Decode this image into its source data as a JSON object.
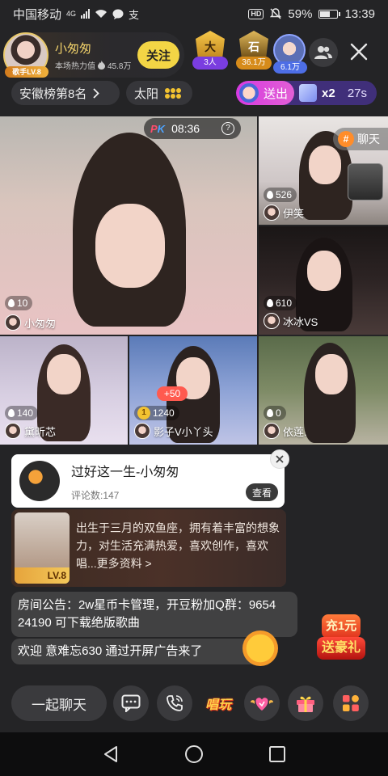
{
  "status_bar": {
    "carrier": "中国移动",
    "network": "4G",
    "misc_icon": "支",
    "hd": "HD",
    "battery": "59%",
    "battery_level": 0.59,
    "time": "13:39"
  },
  "host": {
    "name": "小匆匆",
    "heat_label": "本场热力值",
    "heat_value": "45.8万",
    "level_badge": "歌手LV.8",
    "follow_label": "关注"
  },
  "top_ranks": [
    {
      "crest": "大",
      "count": "3人",
      "icon": "crown-badge-icon"
    },
    {
      "crest": "石",
      "count": "36.1万",
      "icon": "crest-badge-icon"
    },
    {
      "count": "6.1万"
    }
  ],
  "rank_pill": {
    "label": "安徽榜第8名"
  },
  "sun_pill": {
    "label": "太阳"
  },
  "gift_pill": {
    "send_label": "送出",
    "multiplier": "x2",
    "timer": "27s"
  },
  "pk": {
    "label": "PK",
    "timer": "08:36"
  },
  "tiles": [
    {
      "likes": "10",
      "name": "小匆匆"
    },
    {
      "likes": "526",
      "name": "伊笑",
      "tag": "聊天"
    },
    {
      "likes": "610",
      "name": "冰冰VS"
    },
    {
      "likes": "140",
      "name": "黛昕芯"
    },
    {
      "likes": "1240",
      "name": "影子V小丫头",
      "coin": "1",
      "bonus": "+50"
    },
    {
      "likes": "0",
      "name": "依莲."
    }
  ],
  "song_card": {
    "title": "过好这一生-小匆匆",
    "comments": "评论数:147",
    "view_label": "查看"
  },
  "profile": {
    "lv": "LV.8",
    "text": "出生于三月的双鱼座，拥有着丰富的想象力，对生活充满热爱，喜欢创作，喜欢唱...更多资料 >"
  },
  "messages": {
    "announcement": "房间公告：2w星币卡管理，开豆粉加Q群：9654 24190 可下载绝版歌曲",
    "welcome": "欢迎 意难忘630 通过开屏广告来了"
  },
  "charge_badge": {
    "line1": "充1元",
    "line2": "送豪礼"
  },
  "toolbar": {
    "chat_label": "一起聊天",
    "sing_label": "唱玩"
  },
  "colors": {
    "follow": "#f3d545",
    "host_name": "#f3d36b",
    "gift_send": "#d73ae0"
  }
}
